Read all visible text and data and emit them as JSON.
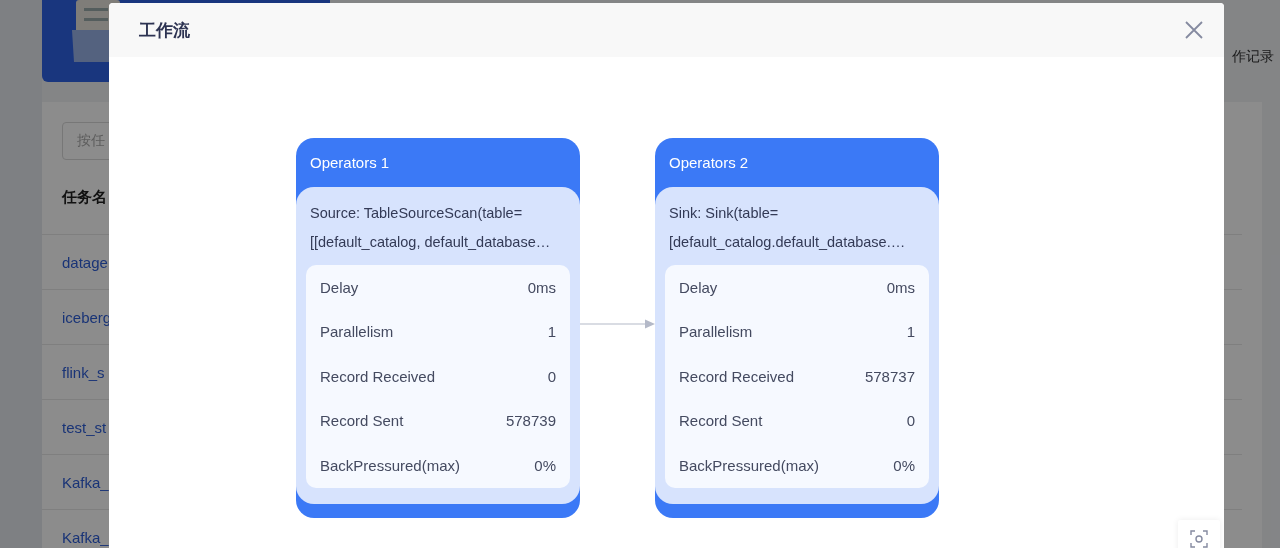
{
  "background_page": {
    "tab_label": "作记录",
    "search": {
      "placeholder": "按任"
    },
    "table": {
      "columns": [
        "任务名"
      ],
      "rows": [
        "datage",
        "iceberg",
        "flink_s",
        "test_st",
        "Kafka_",
        "Kafka_"
      ]
    }
  },
  "modal": {
    "title": "工作流",
    "nodes": [
      {
        "title": "Operators 1",
        "description": [
          "Source: TableSourceScan(table=",
          "[[default_catalog, default_database…"
        ],
        "metrics": [
          {
            "label": "Delay",
            "value": "0ms"
          },
          {
            "label": "Parallelism",
            "value": "1"
          },
          {
            "label": "Record Received",
            "value": "0"
          },
          {
            "label": "Record Sent",
            "value": "578739"
          },
          {
            "label": "BackPressured(max)",
            "value": "0%"
          }
        ]
      },
      {
        "title": "Operators 2",
        "description": [
          "Sink: Sink(table=",
          "[default_catalog.default_database.…"
        ],
        "metrics": [
          {
            "label": "Delay",
            "value": "0ms"
          },
          {
            "label": "Parallelism",
            "value": "1"
          },
          {
            "label": "Record Received",
            "value": "578737"
          },
          {
            "label": "Record Sent",
            "value": "0"
          },
          {
            "label": "BackPressured(max)",
            "value": "0%"
          }
        ]
      }
    ]
  }
}
